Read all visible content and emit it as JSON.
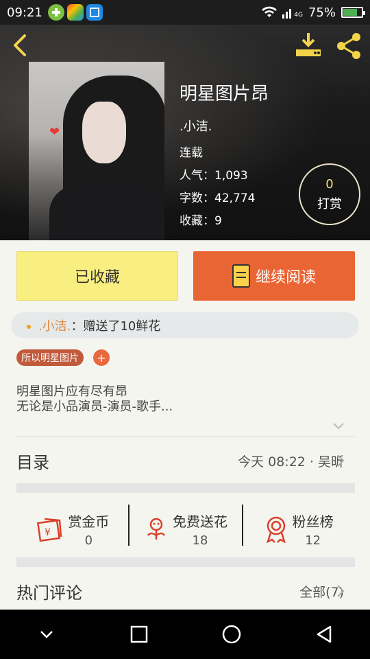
{
  "status_bar": {
    "time": "09:21",
    "signal_text": "4G",
    "battery": "75%",
    "battery_level": 0.75
  },
  "book": {
    "title": "明星图片昂",
    "author": ".小洁.",
    "status": "连载",
    "popularity": "人气：1,093",
    "word_count": "字数：42,774",
    "favorites": "收藏：9"
  },
  "tip": {
    "count": "0",
    "label": "打赏"
  },
  "actions": {
    "favorited_label": "已收藏",
    "continue_label": "继续阅读"
  },
  "gift_notice": {
    "user": ".小洁.",
    "text": "：赠送了10鲜花"
  },
  "tags": {
    "items": [
      "所以明星图片"
    ],
    "add_label": "+"
  },
  "description": {
    "line1": "明星图片应有尽有昂",
    "line2": "无论是小品演员-演员-歌手..."
  },
  "toc": {
    "title": "目录",
    "latest": "今天 08:22 · 吴昕"
  },
  "stats": [
    {
      "label": "赏金币",
      "value": "0",
      "icon": "red-envelope-icon"
    },
    {
      "label": "免费送花",
      "value": "18",
      "icon": "flower-icon"
    },
    {
      "label": "粉丝榜",
      "value": "12",
      "icon": "medal-icon"
    }
  ],
  "comments": {
    "title": "热门评论",
    "all_label": "全部(7)"
  },
  "colors": {
    "accent": "#ea6534",
    "fav_bg": "#f9ee80",
    "icon_red": "#d9412b",
    "tag": "#c1593a"
  }
}
